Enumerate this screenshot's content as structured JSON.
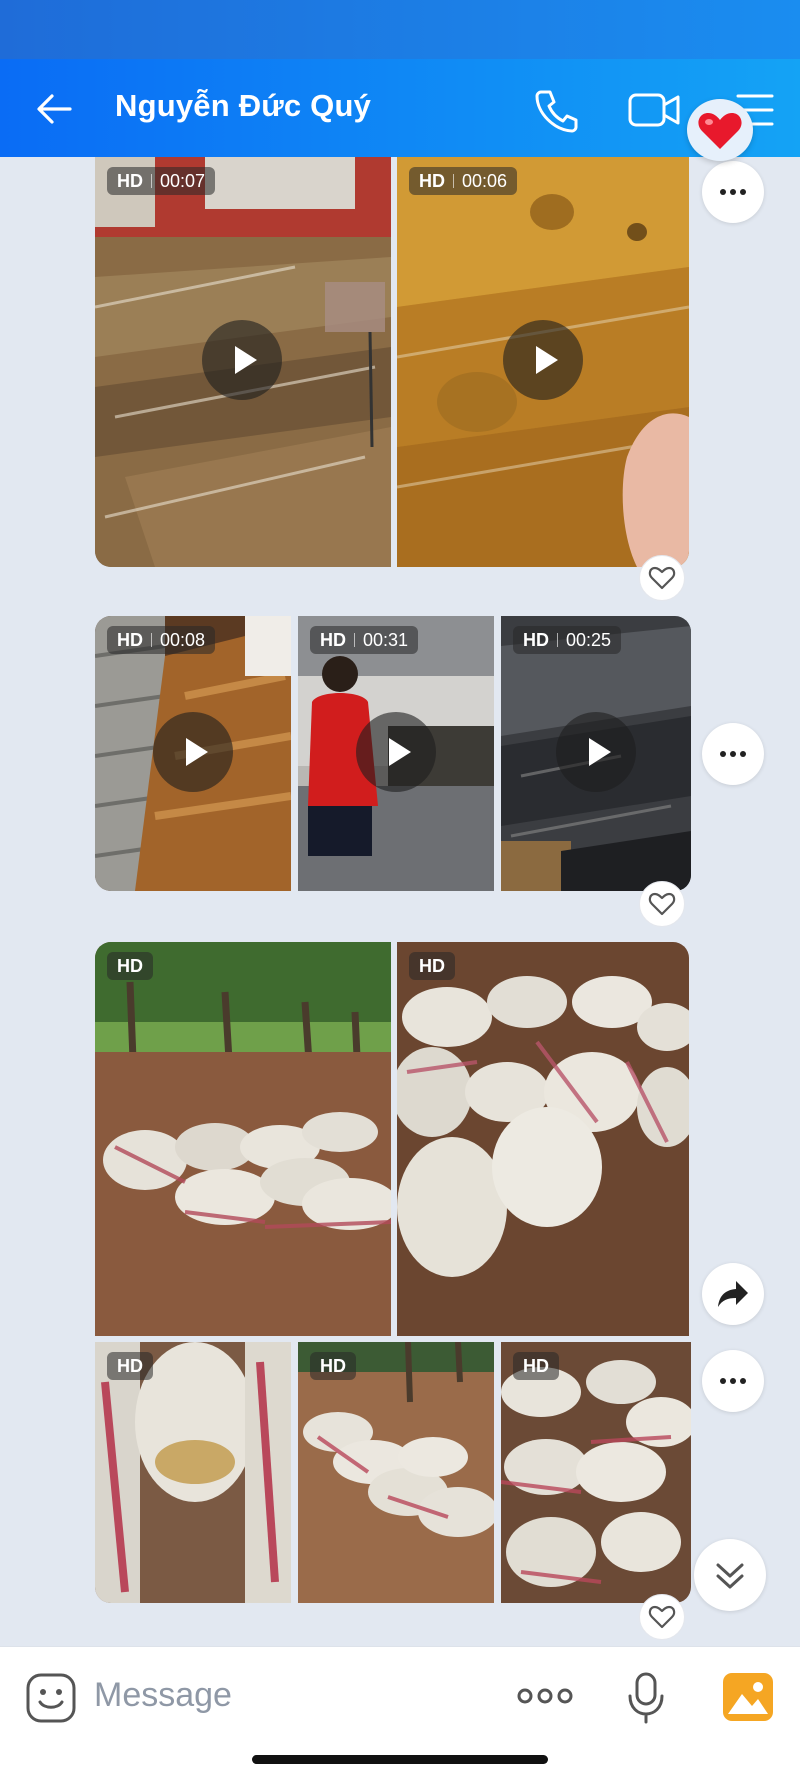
{
  "header": {
    "title": "Nguyễn Đức Quý",
    "back_icon": "arrow-left-icon",
    "call_icon": "phone-icon",
    "video_icon": "video-camera-icon",
    "menu_icon": "list-icon",
    "reaction_icon": "heart-emoji-icon"
  },
  "messages": [
    {
      "layout": "2-videos",
      "media": [
        {
          "type": "video",
          "quality": "HD",
          "duration": "00:07"
        },
        {
          "type": "video",
          "quality": "HD",
          "duration": "00:06"
        }
      ],
      "actions": [
        "more-icon",
        "heart-outline-icon"
      ]
    },
    {
      "layout": "3-videos",
      "media": [
        {
          "type": "video",
          "quality": "HD",
          "duration": "00:08"
        },
        {
          "type": "video",
          "quality": "HD",
          "duration": "00:31"
        },
        {
          "type": "video",
          "quality": "HD",
          "duration": "00:25"
        }
      ],
      "actions": [
        "more-icon",
        "heart-outline-icon"
      ]
    },
    {
      "layout": "5-photos",
      "media": [
        {
          "type": "photo",
          "quality": "HD"
        },
        {
          "type": "photo",
          "quality": "HD"
        },
        {
          "type": "photo",
          "quality": "HD"
        },
        {
          "type": "photo",
          "quality": "HD"
        },
        {
          "type": "photo",
          "quality": "HD"
        }
      ],
      "actions": [
        "forward-icon",
        "more-icon",
        "heart-outline-icon"
      ]
    }
  ],
  "scroll_down_icon": "double-chevron-down-icon",
  "composer": {
    "placeholder": "Message",
    "sticker_icon": "sticker-icon",
    "more_icon": "more-horizontal-icon",
    "mic_icon": "microphone-icon",
    "gallery_icon": "image-gallery-icon"
  },
  "colors": {
    "header_start": "#0a6cf5",
    "header_end": "#14a3f5",
    "background": "#e2e8f1",
    "gallery_orange": "#f5a623"
  }
}
